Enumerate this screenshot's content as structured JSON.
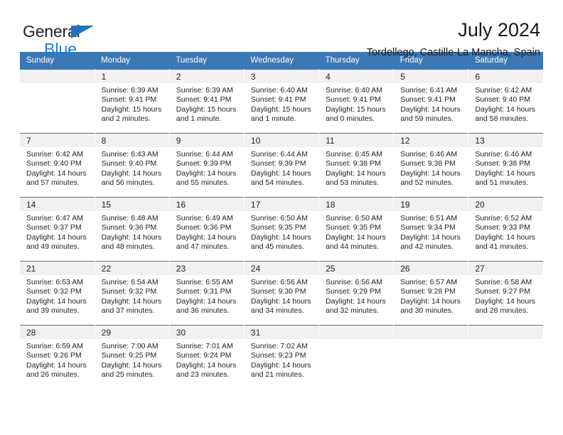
{
  "brand": {
    "name_part1": "General",
    "name_part2": "Blue",
    "triangle_color": "#1f72bd",
    "blue_color": "#1b7fd4"
  },
  "header": {
    "title": "July 2024",
    "subtitle": "Tordellego, Castille-La Mancha, Spain"
  },
  "theme": {
    "header_blue": "#3c78b4",
    "daynum_band": "#f1f1f1",
    "text": "#222222"
  },
  "calendar": {
    "weekday_headers": [
      "Sunday",
      "Monday",
      "Tuesday",
      "Wednesday",
      "Thursday",
      "Friday",
      "Saturday"
    ],
    "weeks": [
      [
        {
          "day": "",
          "sunrise": "",
          "sunset": "",
          "daylight_line1": "",
          "daylight_line2": ""
        },
        {
          "day": "1",
          "sunrise": "Sunrise: 6:39 AM",
          "sunset": "Sunset: 9:41 PM",
          "daylight_line1": "Daylight: 15 hours",
          "daylight_line2": "and 2 minutes."
        },
        {
          "day": "2",
          "sunrise": "Sunrise: 6:39 AM",
          "sunset": "Sunset: 9:41 PM",
          "daylight_line1": "Daylight: 15 hours",
          "daylight_line2": "and 1 minute."
        },
        {
          "day": "3",
          "sunrise": "Sunrise: 6:40 AM",
          "sunset": "Sunset: 9:41 PM",
          "daylight_line1": "Daylight: 15 hours",
          "daylight_line2": "and 1 minute."
        },
        {
          "day": "4",
          "sunrise": "Sunrise: 6:40 AM",
          "sunset": "Sunset: 9:41 PM",
          "daylight_line1": "Daylight: 15 hours",
          "daylight_line2": "and 0 minutes."
        },
        {
          "day": "5",
          "sunrise": "Sunrise: 6:41 AM",
          "sunset": "Sunset: 9:41 PM",
          "daylight_line1": "Daylight: 14 hours",
          "daylight_line2": "and 59 minutes."
        },
        {
          "day": "6",
          "sunrise": "Sunrise: 6:42 AM",
          "sunset": "Sunset: 9:40 PM",
          "daylight_line1": "Daylight: 14 hours",
          "daylight_line2": "and 58 minutes."
        }
      ],
      [
        {
          "day": "7",
          "sunrise": "Sunrise: 6:42 AM",
          "sunset": "Sunset: 9:40 PM",
          "daylight_line1": "Daylight: 14 hours",
          "daylight_line2": "and 57 minutes."
        },
        {
          "day": "8",
          "sunrise": "Sunrise: 6:43 AM",
          "sunset": "Sunset: 9:40 PM",
          "daylight_line1": "Daylight: 14 hours",
          "daylight_line2": "and 56 minutes."
        },
        {
          "day": "9",
          "sunrise": "Sunrise: 6:44 AM",
          "sunset": "Sunset: 9:39 PM",
          "daylight_line1": "Daylight: 14 hours",
          "daylight_line2": "and 55 minutes."
        },
        {
          "day": "10",
          "sunrise": "Sunrise: 6:44 AM",
          "sunset": "Sunset: 9:39 PM",
          "daylight_line1": "Daylight: 14 hours",
          "daylight_line2": "and 54 minutes."
        },
        {
          "day": "11",
          "sunrise": "Sunrise: 6:45 AM",
          "sunset": "Sunset: 9:38 PM",
          "daylight_line1": "Daylight: 14 hours",
          "daylight_line2": "and 53 minutes."
        },
        {
          "day": "12",
          "sunrise": "Sunrise: 6:46 AM",
          "sunset": "Sunset: 9:38 PM",
          "daylight_line1": "Daylight: 14 hours",
          "daylight_line2": "and 52 minutes."
        },
        {
          "day": "13",
          "sunrise": "Sunrise: 6:46 AM",
          "sunset": "Sunset: 9:38 PM",
          "daylight_line1": "Daylight: 14 hours",
          "daylight_line2": "and 51 minutes."
        }
      ],
      [
        {
          "day": "14",
          "sunrise": "Sunrise: 6:47 AM",
          "sunset": "Sunset: 9:37 PM",
          "daylight_line1": "Daylight: 14 hours",
          "daylight_line2": "and 49 minutes."
        },
        {
          "day": "15",
          "sunrise": "Sunrise: 6:48 AM",
          "sunset": "Sunset: 9:36 PM",
          "daylight_line1": "Daylight: 14 hours",
          "daylight_line2": "and 48 minutes."
        },
        {
          "day": "16",
          "sunrise": "Sunrise: 6:49 AM",
          "sunset": "Sunset: 9:36 PM",
          "daylight_line1": "Daylight: 14 hours",
          "daylight_line2": "and 47 minutes."
        },
        {
          "day": "17",
          "sunrise": "Sunrise: 6:50 AM",
          "sunset": "Sunset: 9:35 PM",
          "daylight_line1": "Daylight: 14 hours",
          "daylight_line2": "and 45 minutes."
        },
        {
          "day": "18",
          "sunrise": "Sunrise: 6:50 AM",
          "sunset": "Sunset: 9:35 PM",
          "daylight_line1": "Daylight: 14 hours",
          "daylight_line2": "and 44 minutes."
        },
        {
          "day": "19",
          "sunrise": "Sunrise: 6:51 AM",
          "sunset": "Sunset: 9:34 PM",
          "daylight_line1": "Daylight: 14 hours",
          "daylight_line2": "and 42 minutes."
        },
        {
          "day": "20",
          "sunrise": "Sunrise: 6:52 AM",
          "sunset": "Sunset: 9:33 PM",
          "daylight_line1": "Daylight: 14 hours",
          "daylight_line2": "and 41 minutes."
        }
      ],
      [
        {
          "day": "21",
          "sunrise": "Sunrise: 6:53 AM",
          "sunset": "Sunset: 9:32 PM",
          "daylight_line1": "Daylight: 14 hours",
          "daylight_line2": "and 39 minutes."
        },
        {
          "day": "22",
          "sunrise": "Sunrise: 6:54 AM",
          "sunset": "Sunset: 9:32 PM",
          "daylight_line1": "Daylight: 14 hours",
          "daylight_line2": "and 37 minutes."
        },
        {
          "day": "23",
          "sunrise": "Sunrise: 6:55 AM",
          "sunset": "Sunset: 9:31 PM",
          "daylight_line1": "Daylight: 14 hours",
          "daylight_line2": "and 36 minutes."
        },
        {
          "day": "24",
          "sunrise": "Sunrise: 6:56 AM",
          "sunset": "Sunset: 9:30 PM",
          "daylight_line1": "Daylight: 14 hours",
          "daylight_line2": "and 34 minutes."
        },
        {
          "day": "25",
          "sunrise": "Sunrise: 6:56 AM",
          "sunset": "Sunset: 9:29 PM",
          "daylight_line1": "Daylight: 14 hours",
          "daylight_line2": "and 32 minutes."
        },
        {
          "day": "26",
          "sunrise": "Sunrise: 6:57 AM",
          "sunset": "Sunset: 9:28 PM",
          "daylight_line1": "Daylight: 14 hours",
          "daylight_line2": "and 30 minutes."
        },
        {
          "day": "27",
          "sunrise": "Sunrise: 6:58 AM",
          "sunset": "Sunset: 9:27 PM",
          "daylight_line1": "Daylight: 14 hours",
          "daylight_line2": "and 28 minutes."
        }
      ],
      [
        {
          "day": "28",
          "sunrise": "Sunrise: 6:59 AM",
          "sunset": "Sunset: 9:26 PM",
          "daylight_line1": "Daylight: 14 hours",
          "daylight_line2": "and 26 minutes."
        },
        {
          "day": "29",
          "sunrise": "Sunrise: 7:00 AM",
          "sunset": "Sunset: 9:25 PM",
          "daylight_line1": "Daylight: 14 hours",
          "daylight_line2": "and 25 minutes."
        },
        {
          "day": "30",
          "sunrise": "Sunrise: 7:01 AM",
          "sunset": "Sunset: 9:24 PM",
          "daylight_line1": "Daylight: 14 hours",
          "daylight_line2": "and 23 minutes."
        },
        {
          "day": "31",
          "sunrise": "Sunrise: 7:02 AM",
          "sunset": "Sunset: 9:23 PM",
          "daylight_line1": "Daylight: 14 hours",
          "daylight_line2": "and 21 minutes."
        },
        {
          "day": "",
          "sunrise": "",
          "sunset": "",
          "daylight_line1": "",
          "daylight_line2": ""
        },
        {
          "day": "",
          "sunrise": "",
          "sunset": "",
          "daylight_line1": "",
          "daylight_line2": ""
        },
        {
          "day": "",
          "sunrise": "",
          "sunset": "",
          "daylight_line1": "",
          "daylight_line2": ""
        }
      ]
    ]
  }
}
